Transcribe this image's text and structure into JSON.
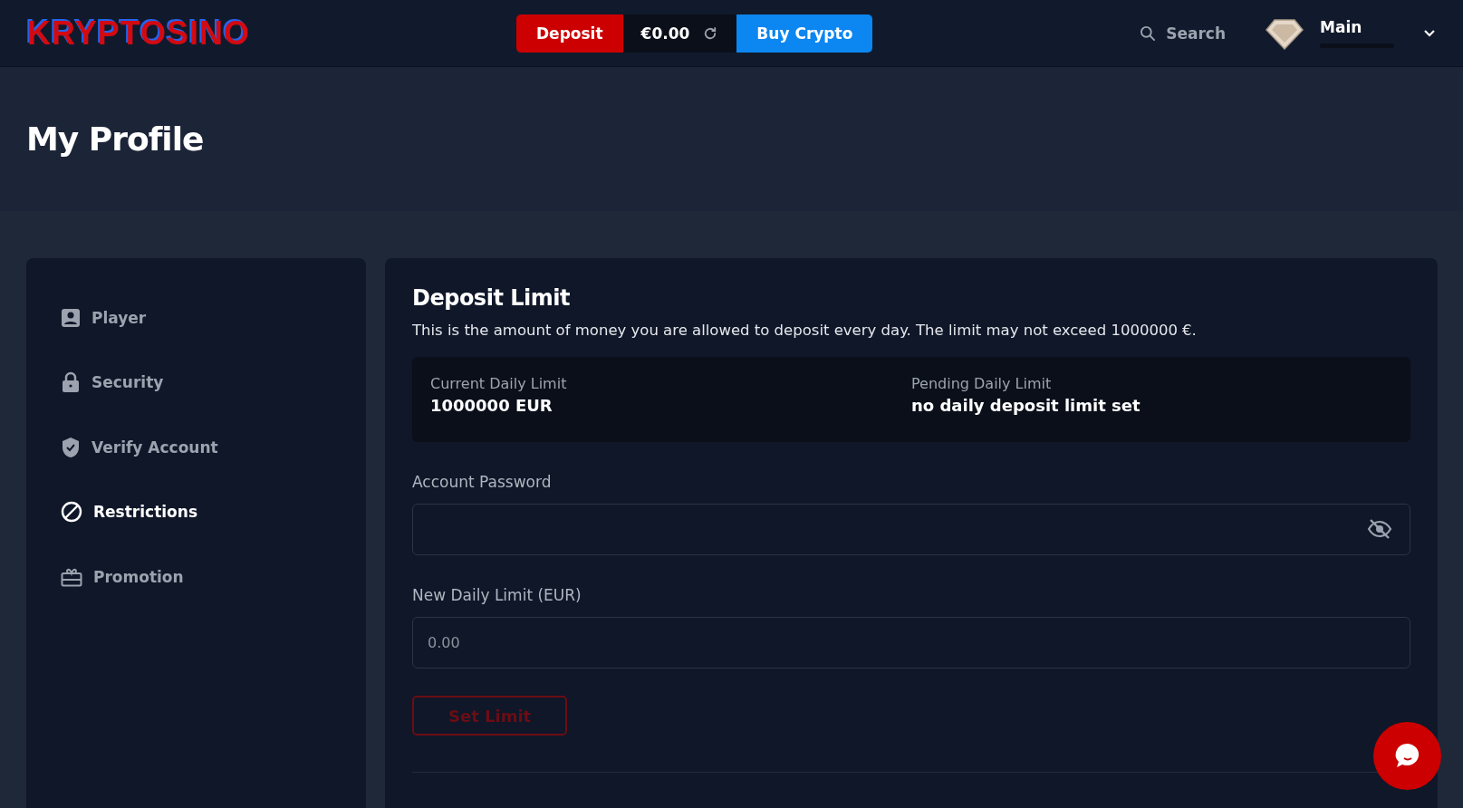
{
  "header": {
    "logo": "KRYPTOSINO",
    "deposit_button": "Deposit",
    "balance": "€0.00",
    "buy_button": "Buy Crypto",
    "search": "Search",
    "account": "Main"
  },
  "page_title": "My Profile",
  "sidebar": {
    "items": [
      {
        "label": "Player",
        "kind": "player",
        "selected": false
      },
      {
        "label": "Security",
        "kind": "security",
        "selected": false
      },
      {
        "label": "Verify Account",
        "kind": "verify",
        "selected": false
      },
      {
        "label": "Restrictions",
        "kind": "restrictions",
        "selected": true
      },
      {
        "label": "Promotion",
        "kind": "promotion",
        "selected": false
      }
    ]
  },
  "panel": {
    "title": "Deposit Limit",
    "description": "This is the amount of money you are allowed to deposit every day. The limit may not exceed 1000000 €.",
    "limits": [
      {
        "label": "Current Daily Limit",
        "value": "1000000 EUR"
      },
      {
        "label": "Pending Daily Limit",
        "value": "no daily deposit limit set"
      }
    ],
    "fields": [
      {
        "label": "Account Password",
        "kind": "password"
      },
      {
        "label": "New Daily Limit (EUR)",
        "kind": "number",
        "placeholder": "0.00"
      }
    ],
    "submit": {
      "label": "Set Limit",
      "disabled": true
    }
  }
}
